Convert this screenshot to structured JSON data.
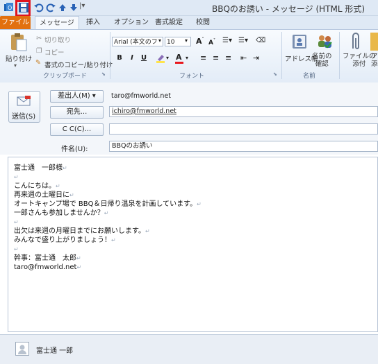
{
  "window": {
    "title": "BBQのお誘い - メッセージ (HTML 形式)"
  },
  "tabs": [
    {
      "label": "ファイル"
    },
    {
      "label": "メッセージ"
    },
    {
      "label": "挿入"
    },
    {
      "label": "オプション"
    },
    {
      "label": "書式設定"
    },
    {
      "label": "校閲"
    }
  ],
  "clipboard": {
    "paste": "貼り付け",
    "cut": "切り取り",
    "copy": "コピー",
    "format_painter": "書式のコピー/貼り付け",
    "group_label": "クリップボード"
  },
  "font": {
    "font_name": "Arial (本文のフ",
    "font_size": "10",
    "group_label": "フォント"
  },
  "names": {
    "address_book": "アドレス帳",
    "check_names": "名前の\n確認",
    "group_label": "名前"
  },
  "include": {
    "attach_file": "ファイルの\n添付",
    "attach_item": "ア\n添"
  },
  "header": {
    "send": "送信(S)",
    "from_button": "差出人(M) ▾",
    "from_value": "taro@fmworld.net",
    "to_button": "宛先...",
    "to_value": "ichiro@fmworld.net",
    "cc_button": "C C(C)...",
    "cc_value": "",
    "subject_label": "件名(U):",
    "subject_value": "BBQのお誘い"
  },
  "body": {
    "lines": [
      "富士通　一郎様",
      "",
      "こんにちは。",
      "再来週の土曜日に",
      "オートキャンプ場で BBQ＆日帰り温泉を計画しています。",
      "一郎さんも参加しませんか？",
      "",
      "出欠は来週の月曜日までにお願いします。",
      "みんなで盛り上がりましょう！",
      "",
      "幹事：富士通　太郎",
      "taro@fmworld.net"
    ]
  },
  "footer": {
    "person": "富士通 一郎"
  },
  "colors": {
    "file_tab": "#e2700f",
    "highlight": "#e0141e",
    "font_color_red": "#e8181e",
    "highlight_yellow": "#ffe44a"
  }
}
